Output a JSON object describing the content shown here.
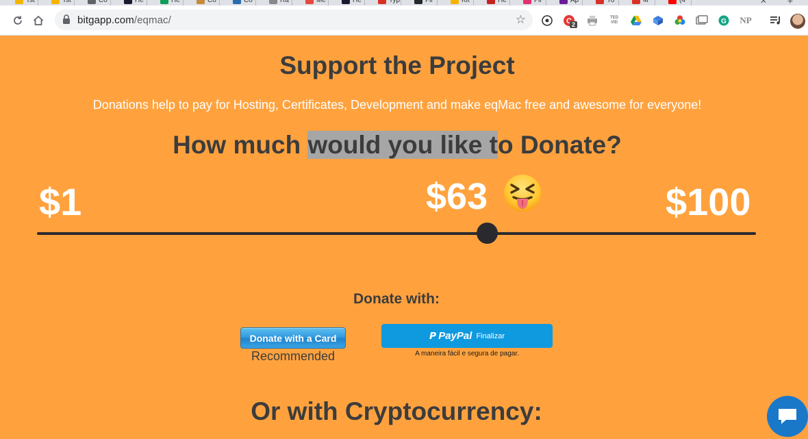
{
  "browser": {
    "tabs": [
      {
        "title": "Tst",
        "color": "#f4b400"
      },
      {
        "title": "Tst",
        "color": "#f4b400"
      },
      {
        "title": "Co",
        "color": "#5f6368"
      },
      {
        "title": "He",
        "color": "#1a1a2e"
      },
      {
        "title": "He",
        "color": "#0f9d58"
      },
      {
        "title": "Co",
        "color": "#c68a3a"
      },
      {
        "title": "Co",
        "color": "#2b6cb0"
      },
      {
        "title": "Ra",
        "color": "#888888"
      },
      {
        "title": "Me",
        "color": "#e8453c"
      },
      {
        "title": "He",
        "color": "#1a1a2e"
      },
      {
        "title": "Typ",
        "color": "#d93025"
      },
      {
        "title": "Fil",
        "color": "#24292e"
      },
      {
        "title": "Kit",
        "color": "#f4b400"
      },
      {
        "title": "He",
        "color": "#c5221f"
      },
      {
        "title": "Fil",
        "color": "#e1306c"
      },
      {
        "title": "Ap",
        "color": "#6a1b9a"
      },
      {
        "title": "Yo",
        "color": "#d93025"
      },
      {
        "title": "4i",
        "color": "#d93025"
      },
      {
        "title": "(4",
        "color": "#ff0000"
      }
    ],
    "url_host": "bitgapp.com",
    "url_path": "/eqmac/",
    "badge_count": "2",
    "ted_label": "TED\nVID",
    "np_label": "NP"
  },
  "page": {
    "title": "Support the Project",
    "subtitle": "Donations help to pay for Hosting, Certificates, Development and make eqMac free and awesome for everyone!",
    "question_pre": "How much ",
    "question_sel": "would you like t",
    "question_post": "o Donate?",
    "slider": {
      "min_label": "$1",
      "max_label": "$100",
      "current_label": "$63",
      "min": 1,
      "max": 100,
      "value": 63
    },
    "emoji_icon": "squinting-face-with-tongue",
    "donate_with": "Donate with:",
    "card_button": "Donate with a Card",
    "recommended": "Recommended",
    "paypal_brand": "PayPal",
    "paypal_action": "Finalizar",
    "paypal_tagline": "A maneira fácil e segura de pagar.",
    "crypto_heading": "Or with Cryptocurrency:"
  },
  "colors": {
    "background": "#ffa23e",
    "heading": "#3c3c3c",
    "accent_blue": "#0f9ae0",
    "chat": "#1a78c9"
  }
}
